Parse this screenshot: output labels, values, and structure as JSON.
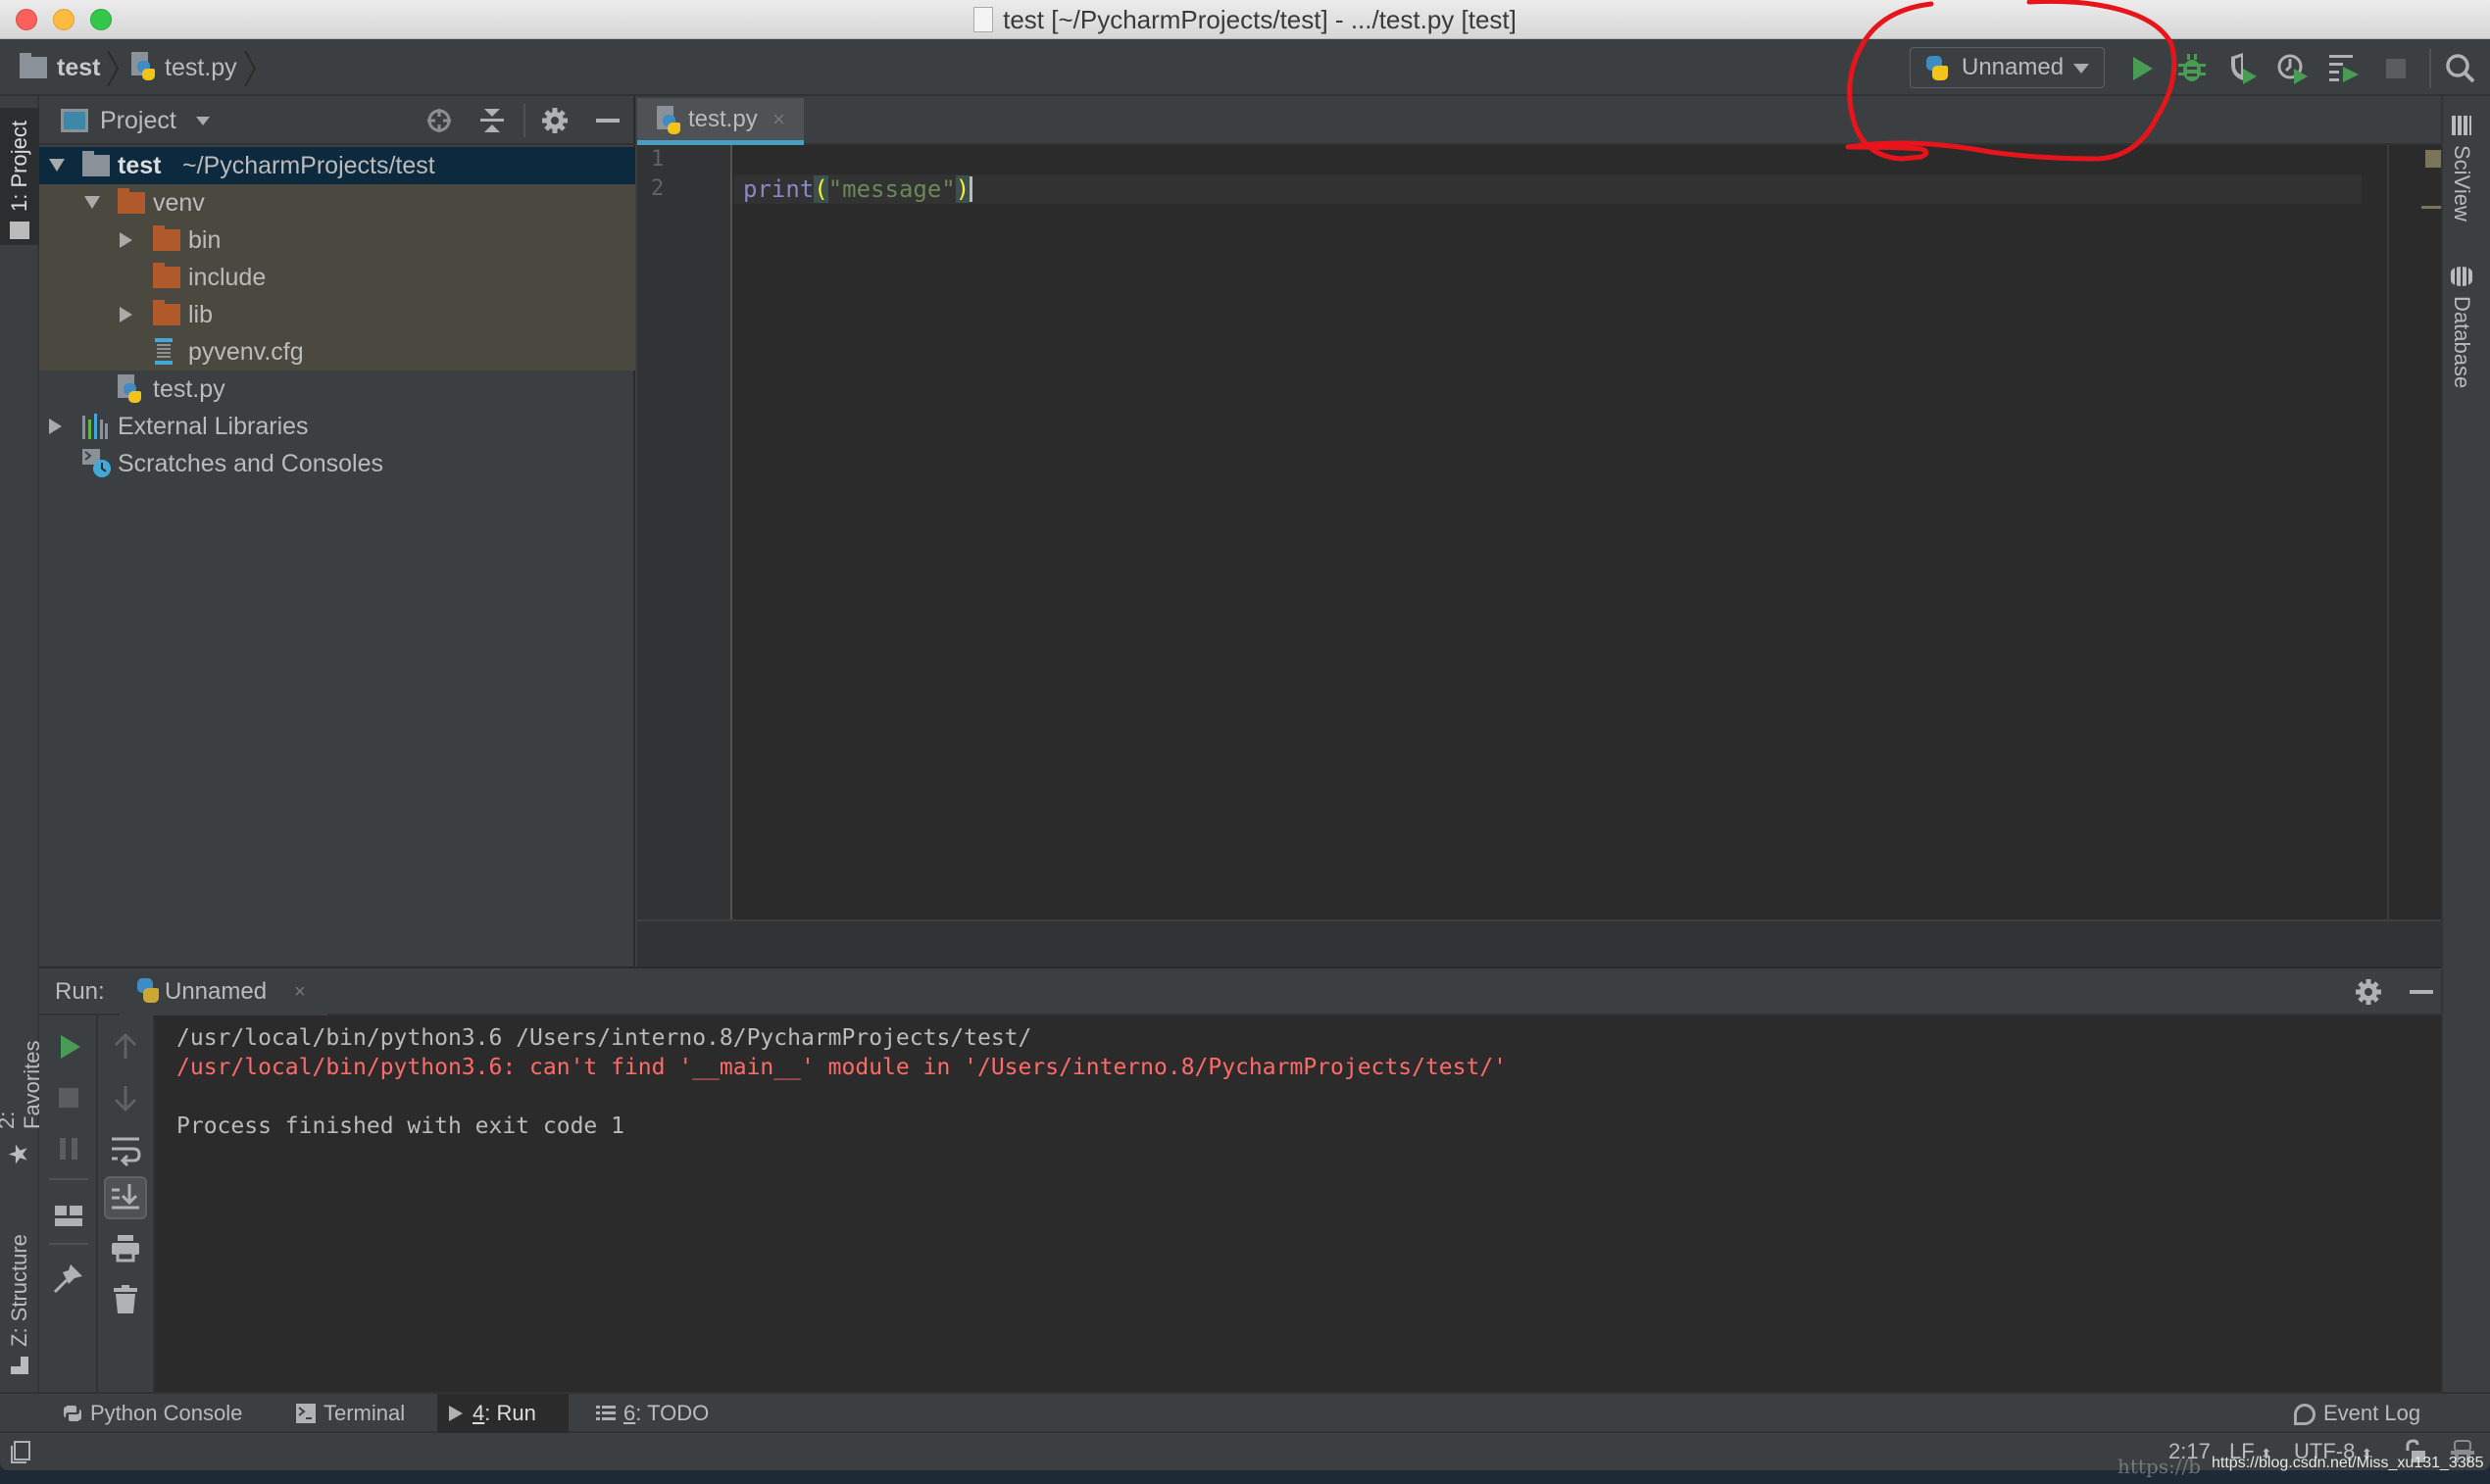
{
  "window": {
    "title": "test [~/PycharmProjects/test] - .../test.py [test]",
    "traffic_lights": [
      {
        "name": "close",
        "color": "#fc605c"
      },
      {
        "name": "minimize",
        "color": "#fdbc40"
      },
      {
        "name": "maximize",
        "color": "#34c84a"
      }
    ]
  },
  "navbar": {
    "breadcrumb": [
      {
        "label": "test",
        "icon": "folder-icon"
      },
      {
        "label": "test.py",
        "icon": "python-file-icon"
      }
    ],
    "run_configuration": {
      "label": "Unnamed",
      "icon": "python-icon"
    },
    "toolbar_buttons": [
      {
        "name": "run",
        "icon": "play-icon",
        "color": "#499c54"
      },
      {
        "name": "debug",
        "icon": "bug-icon",
        "color": "#499c54"
      },
      {
        "name": "run-with-coverage",
        "icon": "coverage-icon"
      },
      {
        "name": "profile",
        "icon": "profile-icon"
      },
      {
        "name": "concurrency-diagram",
        "icon": "concurrency-icon"
      },
      {
        "name": "stop",
        "icon": "stop-icon"
      },
      {
        "name": "search-everywhere",
        "icon": "search-icon"
      }
    ],
    "annotation_color": "#e8141c"
  },
  "left_strip": {
    "tabs": [
      {
        "label": "1: Project",
        "icon": "folder-icon"
      },
      {
        "label": "2: Favorites",
        "icon": "star-icon"
      },
      {
        "label": "Z: Structure",
        "icon": "structure-icon"
      }
    ]
  },
  "right_strip": {
    "tabs": [
      {
        "label": "SciView",
        "icon": "sciview-icon"
      },
      {
        "label": "Database",
        "icon": "database-icon"
      }
    ]
  },
  "project_panel": {
    "title": "Project",
    "tree": [
      {
        "label": "test",
        "suffix": "~/PycharmProjects/test",
        "type": "project-root",
        "expanded": true
      },
      {
        "label": "venv",
        "type": "excluded-folder",
        "expanded": true
      },
      {
        "label": "bin",
        "type": "excluded-folder",
        "expanded": false
      },
      {
        "label": "include",
        "type": "excluded-folder"
      },
      {
        "label": "lib",
        "type": "excluded-folder",
        "expanded": false
      },
      {
        "label": "pyvenv.cfg",
        "type": "config-file"
      },
      {
        "label": "test.py",
        "type": "python-file"
      },
      {
        "label": "External Libraries",
        "type": "libraries",
        "expanded": false
      },
      {
        "label": "Scratches and Consoles",
        "type": "scratches"
      }
    ]
  },
  "editor": {
    "tabs": [
      {
        "label": "test.py",
        "active": true,
        "close": "×"
      }
    ],
    "line_numbers": [
      "1",
      "2"
    ],
    "code": {
      "fn": "print",
      "open_paren": "(",
      "string": "\"message\"",
      "close_paren": ")"
    },
    "cursor": "2:17"
  },
  "run_panel": {
    "label": "Run:",
    "tab": {
      "label": "Unnamed",
      "close": "×"
    },
    "console": [
      {
        "text": "/usr/local/bin/python3.6 /Users/interno.8/PycharmProjects/test/",
        "type": "command"
      },
      {
        "text": "/usr/local/bin/python3.6: can't find '__main__' module in '/Users/interno.8/PycharmProjects/test/'",
        "type": "error"
      },
      {
        "text": "",
        "type": "blank"
      },
      {
        "text": "Process finished with exit code 1",
        "type": "info"
      }
    ]
  },
  "bottom_bar": {
    "tool_windows": [
      {
        "label": "Python Console",
        "mnemonic": "",
        "active": false
      },
      {
        "label": "Terminal",
        "mnemonic": "",
        "active": false
      },
      {
        "mnemonic": "4",
        "label": ": Run",
        "active": true
      },
      {
        "mnemonic": "6",
        "label": ": TODO",
        "active": false
      }
    ],
    "event_log": "Event Log"
  },
  "status_bar": {
    "position": "2:17",
    "line_separator": "LF",
    "encoding": "UTF-8",
    "watermark": "https://blog.csdn.net/Miss_xu131_3385",
    "watermark_faint": "https://b"
  }
}
